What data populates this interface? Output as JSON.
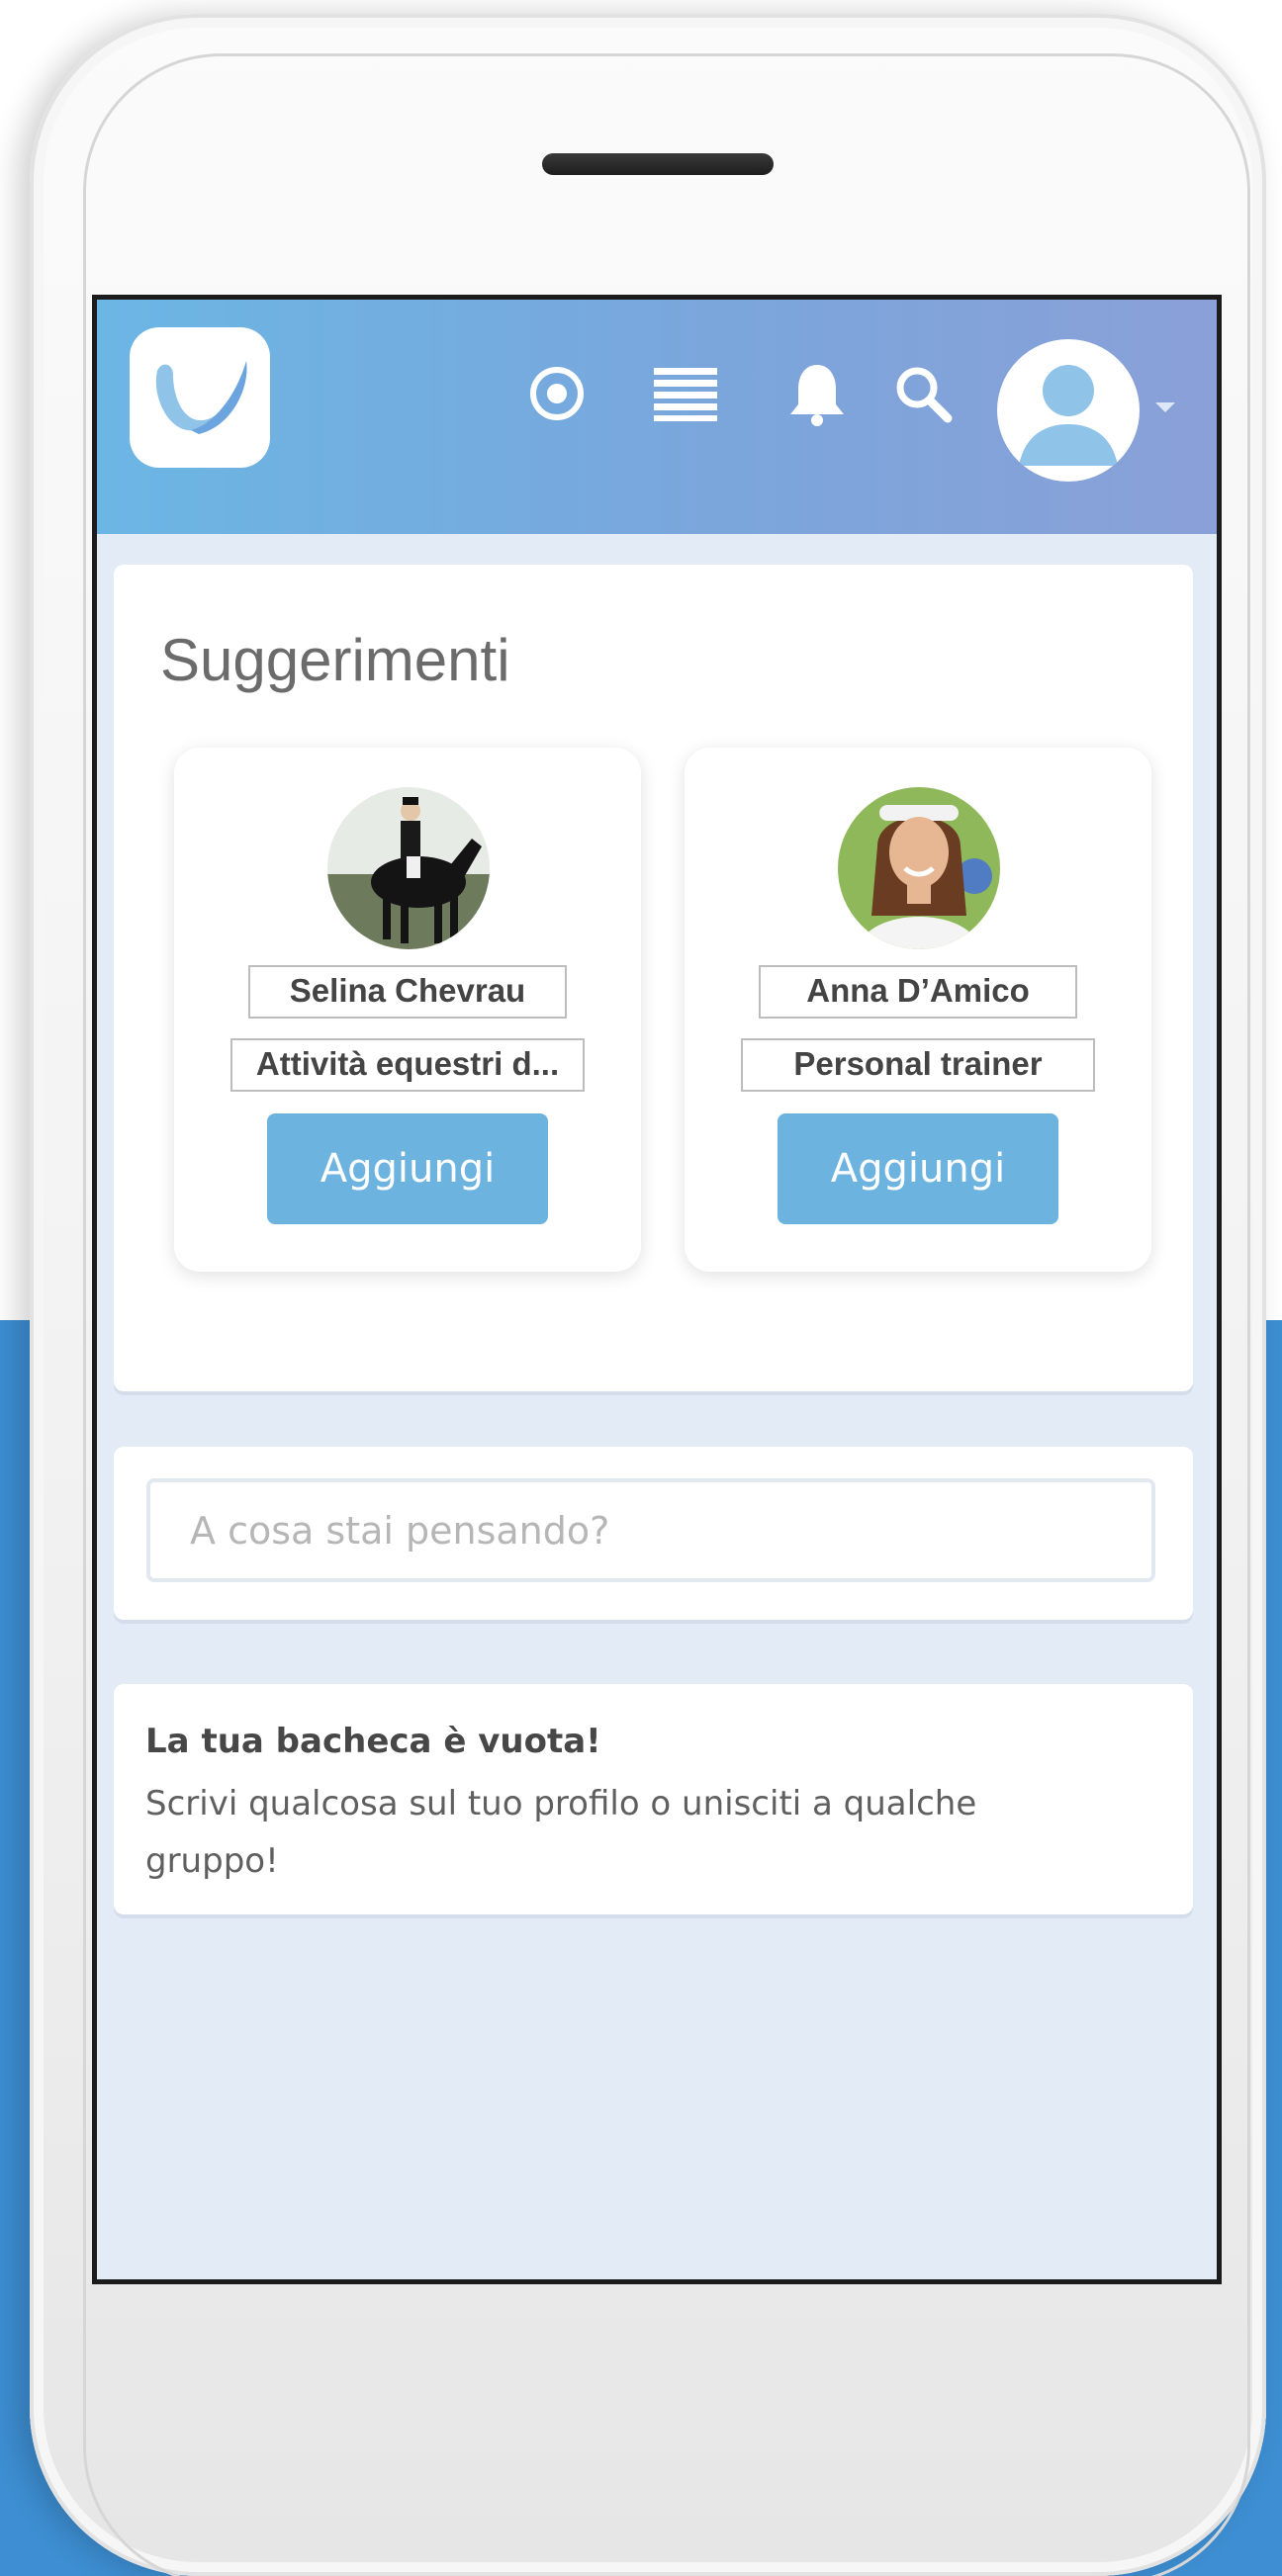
{
  "colors": {
    "header_gradient_start": "#6bb6e4",
    "header_gradient_end": "#8aa0d8",
    "button": "#6db3e0",
    "screen_background": "#e3ecf6",
    "backdrop_blue": "#3d8ed2"
  },
  "header": {
    "logo_icon": "brand-logo-icon",
    "icons": [
      "target-icon",
      "list-icon",
      "bell-icon",
      "search-icon",
      "user-avatar-icon",
      "caret-down-icon"
    ]
  },
  "suggestions": {
    "title": "Suggerimenti",
    "cards": [
      {
        "name": "Selina Chevrau",
        "subtitle": "Attività equestri d...",
        "button_label": "Aggiungi",
        "photo": "rider-on-horse-photo"
      },
      {
        "name": "Anna D’Amico",
        "subtitle": "Personal trainer",
        "button_label": "Aggiungi",
        "photo": "woman-portrait-photo"
      }
    ]
  },
  "composer": {
    "placeholder": "A cosa stai pensando?"
  },
  "feed": {
    "empty_title": "La tua bacheca è vuota!",
    "empty_text": "Scrivi qualcosa sul tuo profilo o unisciti a qualche gruppo!"
  }
}
